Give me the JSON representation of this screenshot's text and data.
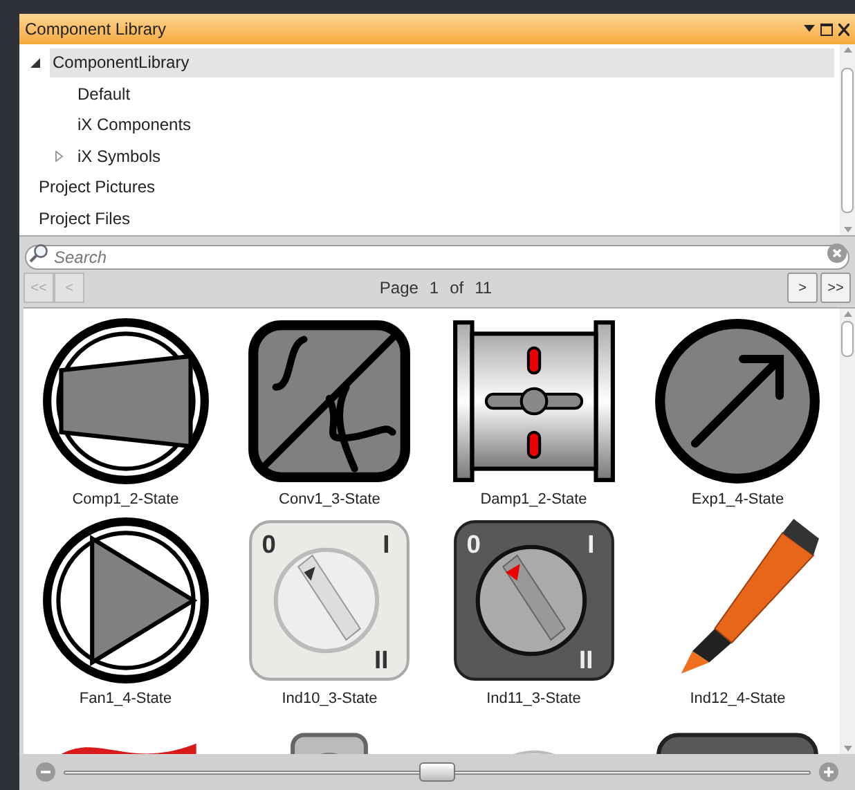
{
  "panel": {
    "title": "Component Library"
  },
  "tree": [
    {
      "label": "ComponentLibrary",
      "expanded": true,
      "selected": true,
      "children": [
        {
          "label": "Default",
          "selected": false
        },
        {
          "label": "iX Components",
          "selected": false
        },
        {
          "label": "iX Symbols",
          "expanded": false,
          "selected": false
        }
      ]
    },
    {
      "label": "Project Pictures",
      "selected": false
    },
    {
      "label": "Project Files",
      "selected": false
    }
  ],
  "search": {
    "placeholder": "Search"
  },
  "pager": {
    "first": "<<",
    "prev": "<",
    "page_label": "Page",
    "page": "1",
    "of_label": "of",
    "total": "11",
    "next": ">",
    "last": ">>"
  },
  "items": [
    {
      "kind": "compressor",
      "label": "Comp1_2-State"
    },
    {
      "kind": "converter",
      "label": "Conv1_3-State"
    },
    {
      "kind": "damper",
      "label": "Damp1_2-State"
    },
    {
      "kind": "expansion",
      "label": "Exp1_4-State"
    },
    {
      "kind": "fan",
      "label": "Fan1_4-State"
    },
    {
      "kind": "switch-light",
      "label": "Ind10_3-State",
      "marks": [
        "0",
        "I",
        "II"
      ]
    },
    {
      "kind": "switch-dark",
      "label": "Ind11_3-State",
      "marks": [
        "0",
        "I",
        "II"
      ]
    },
    {
      "kind": "marker",
      "label": "Ind12_4-State"
    },
    {
      "kind": "flag"
    },
    {
      "kind": "valve"
    },
    {
      "kind": "lamp"
    },
    {
      "kind": "dark-button"
    }
  ],
  "zoom": {
    "level": 0.5
  }
}
